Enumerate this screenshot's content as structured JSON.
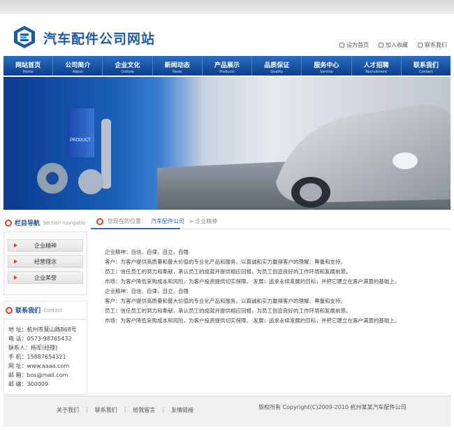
{
  "site": {
    "title": "汽车配件公司网站"
  },
  "toplinks": [
    {
      "label": "设为首页",
      "icon": "home-icon"
    },
    {
      "label": "加入收藏",
      "icon": "bookmark-icon"
    },
    {
      "label": "联系我们",
      "icon": "mail-icon"
    }
  ],
  "nav": [
    {
      "zh": "网站首页",
      "en": "Home"
    },
    {
      "zh": "公司简介",
      "en": "About"
    },
    {
      "zh": "企业文化",
      "en": "Culture"
    },
    {
      "zh": "新闻动态",
      "en": "News"
    },
    {
      "zh": "产品展示",
      "en": "Products"
    },
    {
      "zh": "品质保证",
      "en": "Quality"
    },
    {
      "zh": "服务中心",
      "en": "Service"
    },
    {
      "zh": "人才招聘",
      "en": "Recruitment"
    },
    {
      "zh": "联系我们",
      "en": "Contact"
    }
  ],
  "banner": {
    "product_label": "PRODUCT"
  },
  "sidebar": {
    "nav_title": "栏目导航",
    "nav_title_en": "Section navigatio",
    "menu": [
      "企业精神",
      "经营理念",
      "企业荣誉"
    ],
    "contact_title": "联系我们",
    "contact_title_en": "Contact",
    "contact_lines": [
      "地 址：杭州市莫山路868号",
      "电 话：0573-98765432",
      "联系人：杨军(经理)",
      "手 机：15887654321",
      "网 址：www.aaaa.com",
      "邮 箱：bos@mail.com",
      "邮 编：300009"
    ]
  },
  "breadcrumb": {
    "prefix": "您现在的位置：",
    "link": "汽车配件公司",
    "current": "> 企业精神"
  },
  "content": [
    "企业精神：自信、自律，自立，自强",
    "客户：为客户提供高质量和最大价值的专业化产品和服务，以真诚和实力赢得客户的理解、尊重和支持。",
    "员工：信任员工的努力和奉献，承认员工的成就并提供相应回报，为员工创造良好的工作环境和发展前景。",
    "市场：为客户降低采购成本和风险，为客户投资提供切实保障。 发展：追求永续发展的目标，并把它建立在客户满意的基础上。",
    "企业精神：自信、自律，自立，自强",
    "客户：为客户提供高质量和最大价值的专业化产品和服务，以真诚和实力赢得客户的理解、尊重和支持。",
    "员工：信任员工的努力和奉献，承认员工的成就并提供相应回报，为员工创造良好的工作环境和发展前景。",
    "市场：为客户降低采购成本和风险，为客户投资提供切实保障。 发展：追求永续发展的目标，并把它建立在客户满意的基础上。"
  ],
  "footer": {
    "links": [
      "关于我们",
      "联系我们",
      "给我留言",
      "友情链接"
    ],
    "copyright": "版权所有 Copyright(C)2009-2010 杭州某某汽车配件公司"
  }
}
